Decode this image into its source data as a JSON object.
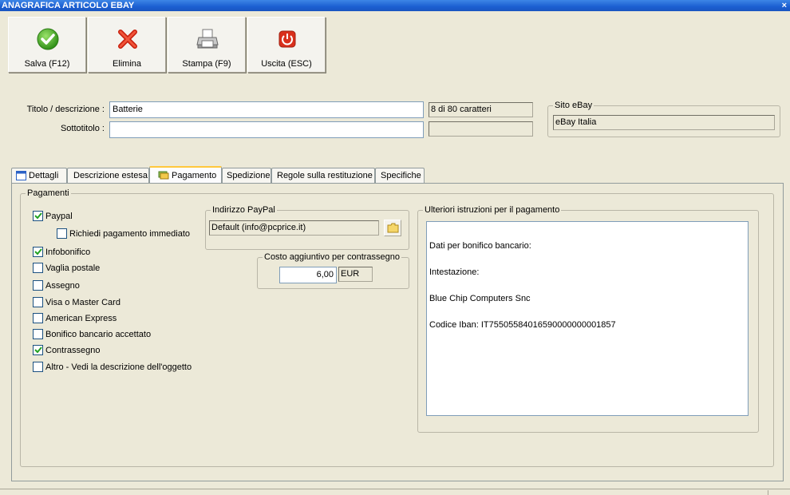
{
  "window": {
    "title": "ANAGRAFICA ARTICOLO EBAY",
    "close_label": "×"
  },
  "toolbar": {
    "buttons": [
      {
        "label": "Salva (F12)",
        "icon": "check-icon"
      },
      {
        "label": "Elimina",
        "icon": "x-icon"
      },
      {
        "label": "Stampa (F9)",
        "icon": "printer-icon"
      },
      {
        "label": "Uscita (ESC)",
        "icon": "power-icon"
      }
    ]
  },
  "form": {
    "title_label": "Titolo / descrizione :",
    "title_value": "Batterie",
    "title_counter": "8 di 80 caratteri",
    "subtitle_label": "Sottotitolo :",
    "subtitle_value": "",
    "subtitle_counter": ""
  },
  "site": {
    "label": "Sito eBay",
    "value": "eBay Italia"
  },
  "tabs": [
    {
      "label": "Dettagli",
      "icon": "window-icon",
      "active": false
    },
    {
      "label": "Descrizione estesa",
      "active": false
    },
    {
      "label": "Pagamento",
      "icon": "payment-icon",
      "active": true
    },
    {
      "label": "Spedizione",
      "active": false
    },
    {
      "label": "Regole sulla restituzione",
      "active": false
    },
    {
      "label": "Specifiche",
      "active": false
    }
  ],
  "payments": {
    "group_label": "Pagamenti",
    "options": [
      {
        "label": "Paypal",
        "checked": true
      },
      {
        "label": "Richiedi pagamento immediato",
        "checked": false
      },
      {
        "label": "Infobonifico",
        "checked": true
      },
      {
        "label": "Vaglia postale",
        "checked": false
      },
      {
        "label": "Assegno",
        "checked": false
      },
      {
        "label": "Visa o Master Card",
        "checked": false
      },
      {
        "label": "American Express",
        "checked": false
      },
      {
        "label": "Bonifico bancario accettato",
        "checked": false
      },
      {
        "label": "Contrassegno",
        "checked": true
      },
      {
        "label": "Altro - Vedi la descrizione dell'oggetto",
        "checked": false
      }
    ]
  },
  "paypal": {
    "group_label": "Indirizzo PayPal",
    "value": "Default (info@pcprice.it)"
  },
  "cod": {
    "group_label": "Costo aggiuntivo per contrassegno",
    "amount": "6,00",
    "currency": "EUR"
  },
  "instructions": {
    "group_label": "Ulteriori istruzioni per il pagamento",
    "lines": [
      "Dati per bonifico bancario:",
      "Intestazione:",
      "Blue Chip Computers Snc",
      "Codice Iban: IT75505584016590000000001857"
    ]
  }
}
